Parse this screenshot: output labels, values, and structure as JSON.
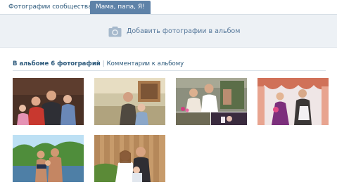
{
  "tabs": [
    {
      "label": "Фотографии сообщества",
      "active": false
    },
    {
      "label": "Мама, папа, Я!",
      "active": true
    }
  ],
  "upload": {
    "label": "Добавить фотографии в альбом",
    "icon": "camera-icon"
  },
  "album": {
    "count_label": "В альбоме 6 фотографий",
    "comments_label": "Комментарии к альбому"
  },
  "colors": {
    "accent": "#5e82a8",
    "link": "#2b587a",
    "upload_bg": "#edf1f5"
  },
  "photos": [
    {
      "name": "family-photo-1"
    },
    {
      "name": "family-photo-2"
    },
    {
      "name": "family-photo-3"
    },
    {
      "name": "family-photo-4"
    },
    {
      "name": "family-photo-5"
    },
    {
      "name": "family-photo-6"
    }
  ]
}
